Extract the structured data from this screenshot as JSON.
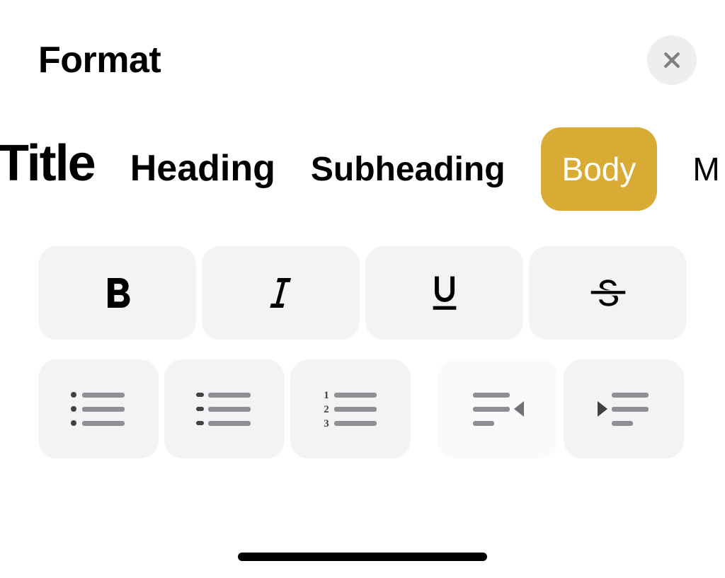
{
  "header": {
    "title": "Format"
  },
  "styles": {
    "title": "Title",
    "heading": "Heading",
    "subheading": "Subheading",
    "body": "Body",
    "monospaced": "M",
    "selected": "body"
  },
  "colors": {
    "accent": "#d8ab34",
    "button_bg": "#f3f2f4"
  }
}
